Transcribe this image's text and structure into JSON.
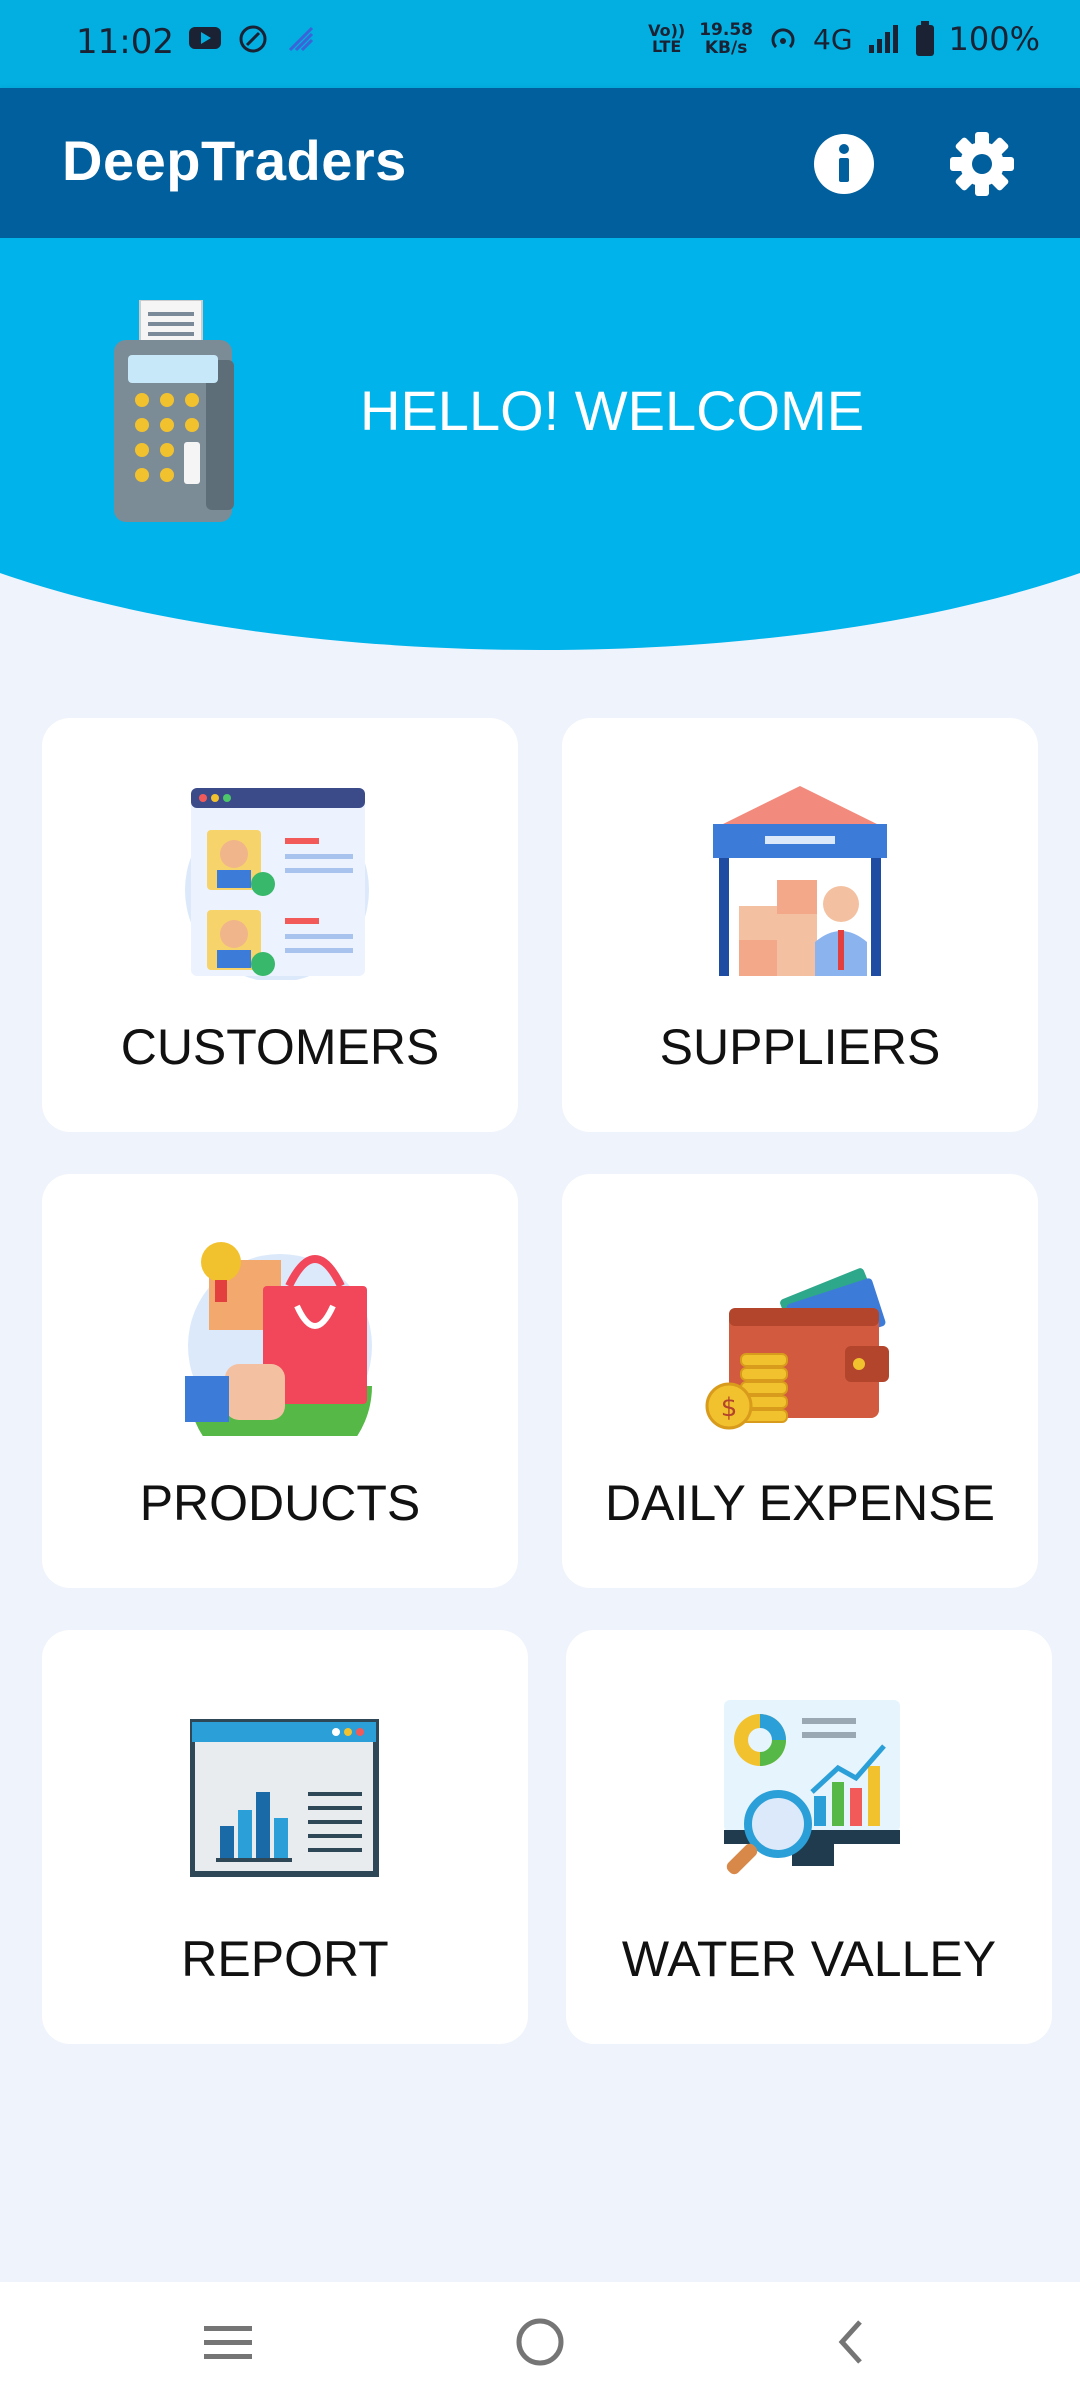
{
  "status_bar": {
    "time": "11:02",
    "volte": "Vo)) LTE",
    "speed_value": "19.58",
    "speed_unit": "KB/s",
    "network": "4G",
    "battery": "100%"
  },
  "app_bar": {
    "title": "DeepTraders",
    "info_icon": "info-icon",
    "settings_icon": "gear-icon"
  },
  "hero": {
    "welcome_text": "HELLO! WELCOME",
    "icon": "card-payment-terminal-icon"
  },
  "menu": {
    "items": [
      {
        "label": "CUSTOMERS",
        "icon": "customers-icon"
      },
      {
        "label": "SUPPLIERS",
        "icon": "suppliers-icon"
      },
      {
        "label": "PRODUCTS",
        "icon": "products-icon"
      },
      {
        "label": "DAILY EXPENSE",
        "icon": "wallet-icon"
      },
      {
        "label": "REPORT",
        "icon": "report-icon"
      },
      {
        "label": "WATER VALLEY",
        "icon": "analytics-icon"
      }
    ]
  },
  "colors": {
    "status_bar": "#03aee0",
    "app_bar": "#005f9c",
    "hero": "#00b3ea",
    "background": "#eef3fc",
    "card": "#ffffff"
  },
  "nav_bar": {
    "recents_icon": "menu-icon",
    "home_icon": "home-circle-icon",
    "back_icon": "back-chevron-icon"
  }
}
